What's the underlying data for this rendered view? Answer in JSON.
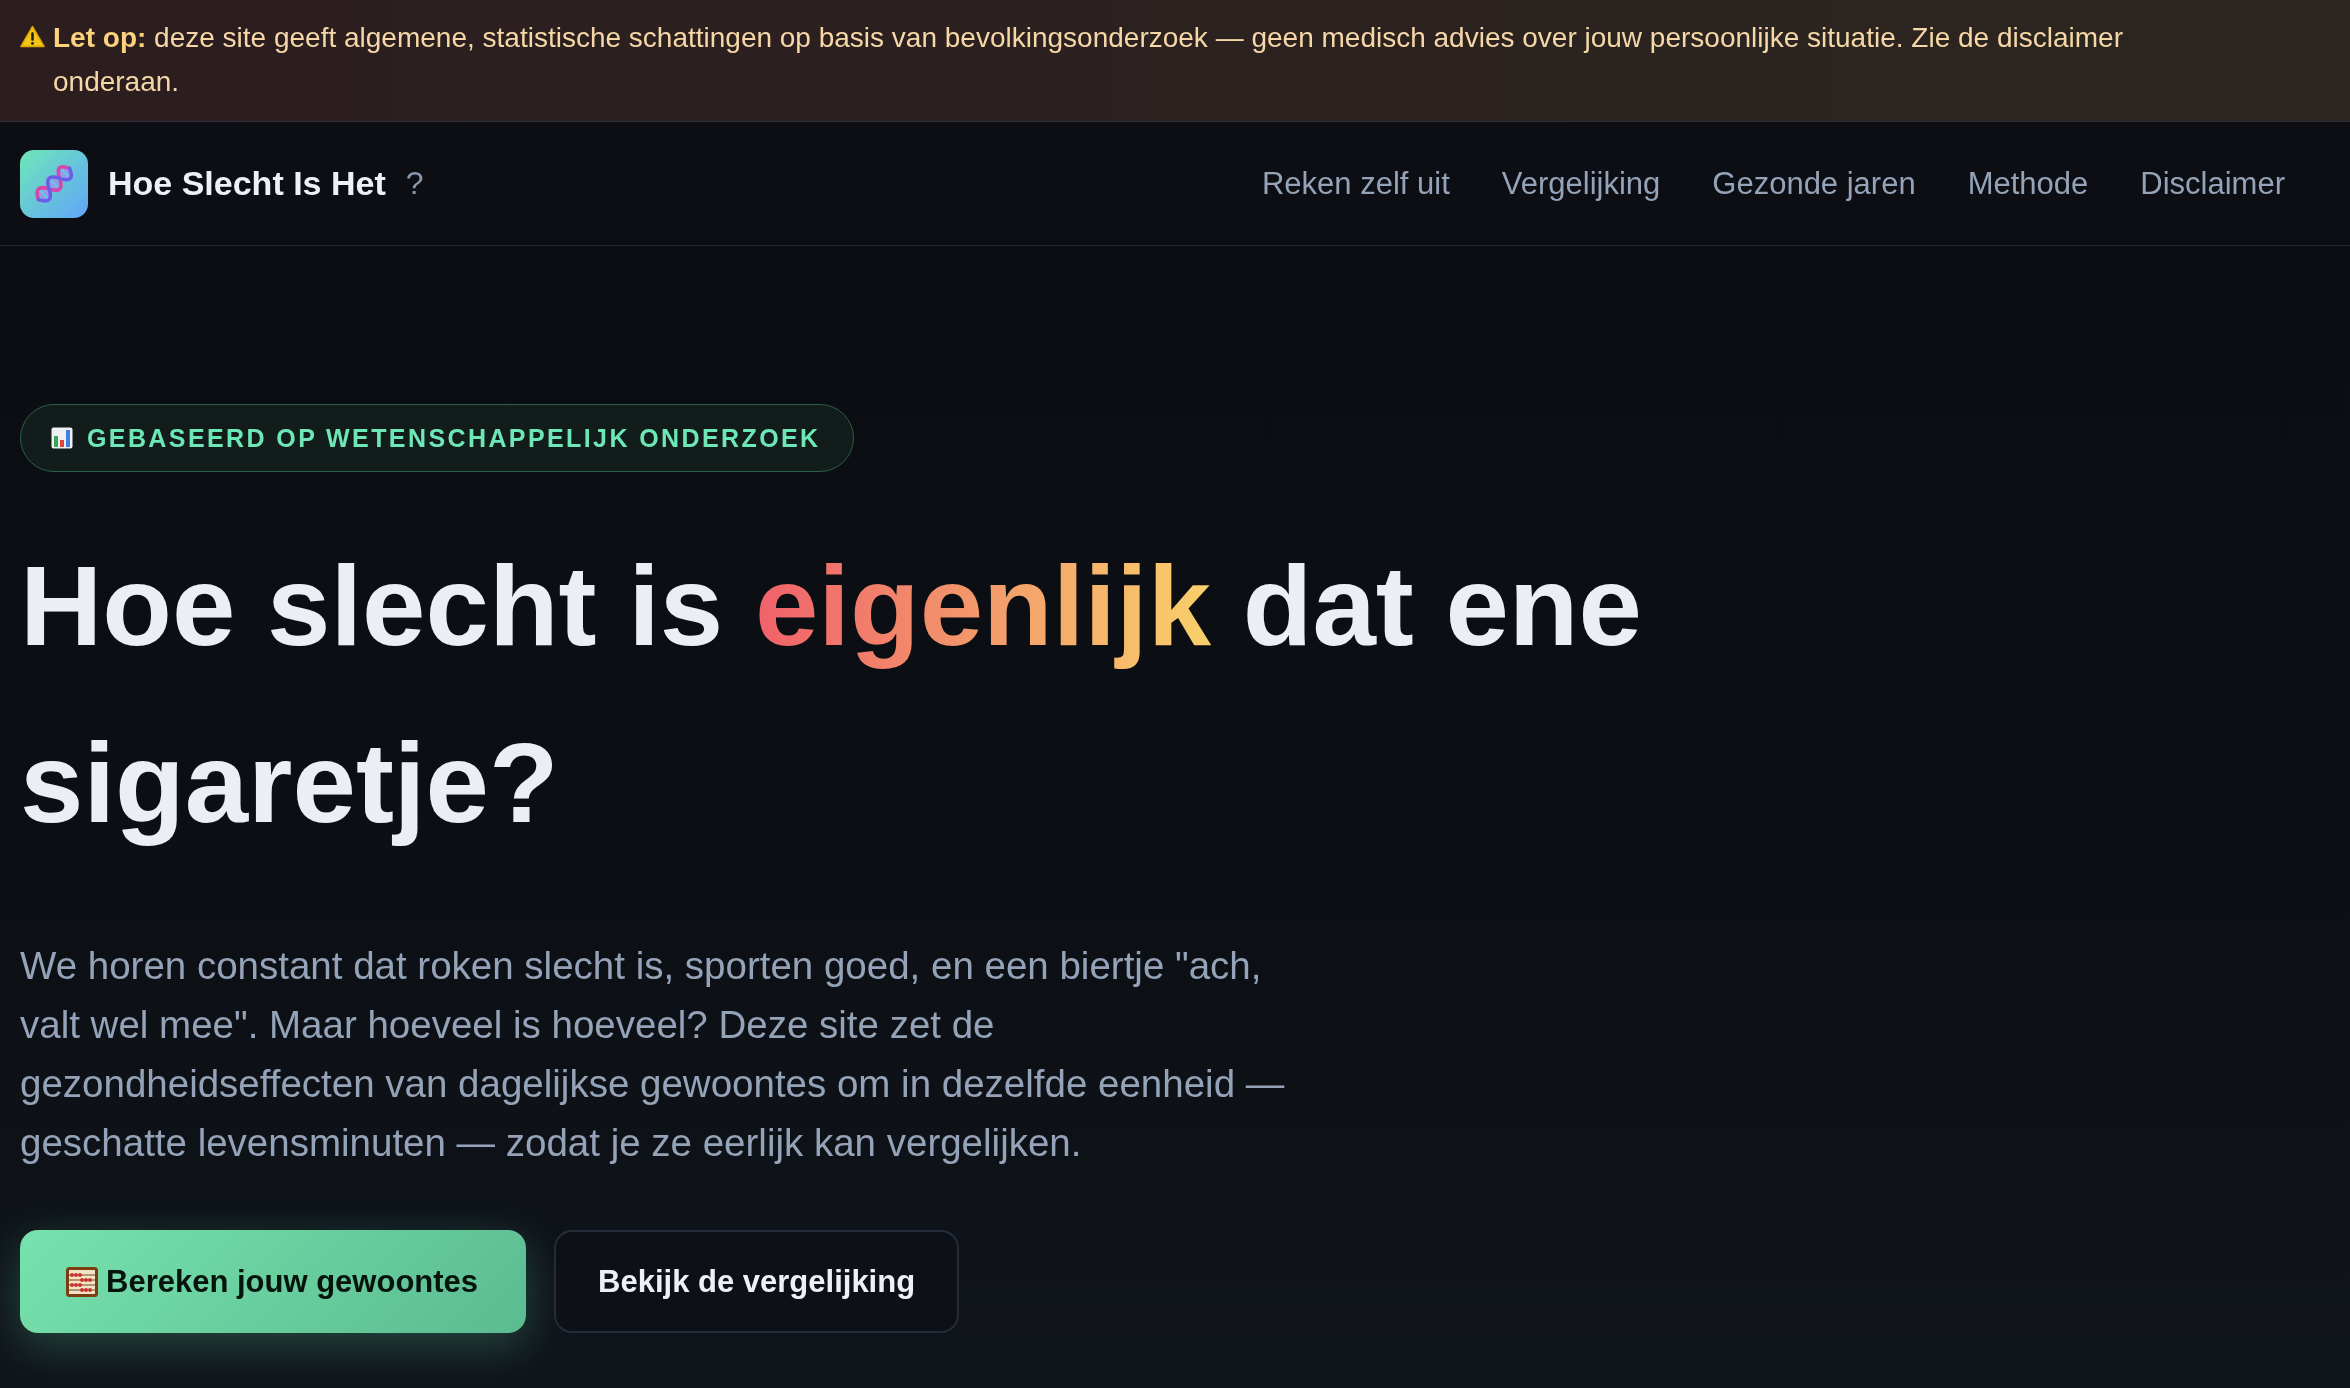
{
  "notice": {
    "text": "**Let op:** deze site geeft algemene, statistische schattingen op basis van bevolkingsonderzoek — geen medisch advies over jouw persoonlijke situatie. Zie de disclaimer onderaan."
  },
  "header": {
    "site_title": "Hoe Slecht Is Het",
    "help": "?",
    "nav": [
      "Reken zelf uit",
      "Vergelijking",
      "Gezonde jaren",
      "Methode",
      "Disclaimer"
    ]
  },
  "hero": {
    "badge": "GEBASEERD OP WETENSCHAPPELIJK ONDERZOEK",
    "headline": [
      {
        "text": "Hoe slecht is ",
        "highlight": false
      },
      {
        "text": "eigenlijk",
        "highlight": true
      },
      {
        "text": " dat ene sigaretje?",
        "highlight": false
      }
    ],
    "intro": "We horen constant dat roken slecht is, sporten goed, en een biertje \"ach, valt wel mee\". Maar hoeveel is hoeveel? Deze site zet de gezondheidseffecten van dagelijkse gewoontes om in dezelfde eenheid — geschatte levensminuten — zodat je ze eerlijk kan vergelijken.",
    "buttons": [
      {
        "label": "Bereken jouw gewoontes",
        "kind": "primary"
      },
      {
        "label": "Bekijk de vergelijking",
        "kind": "secondary"
      }
    ]
  }
}
